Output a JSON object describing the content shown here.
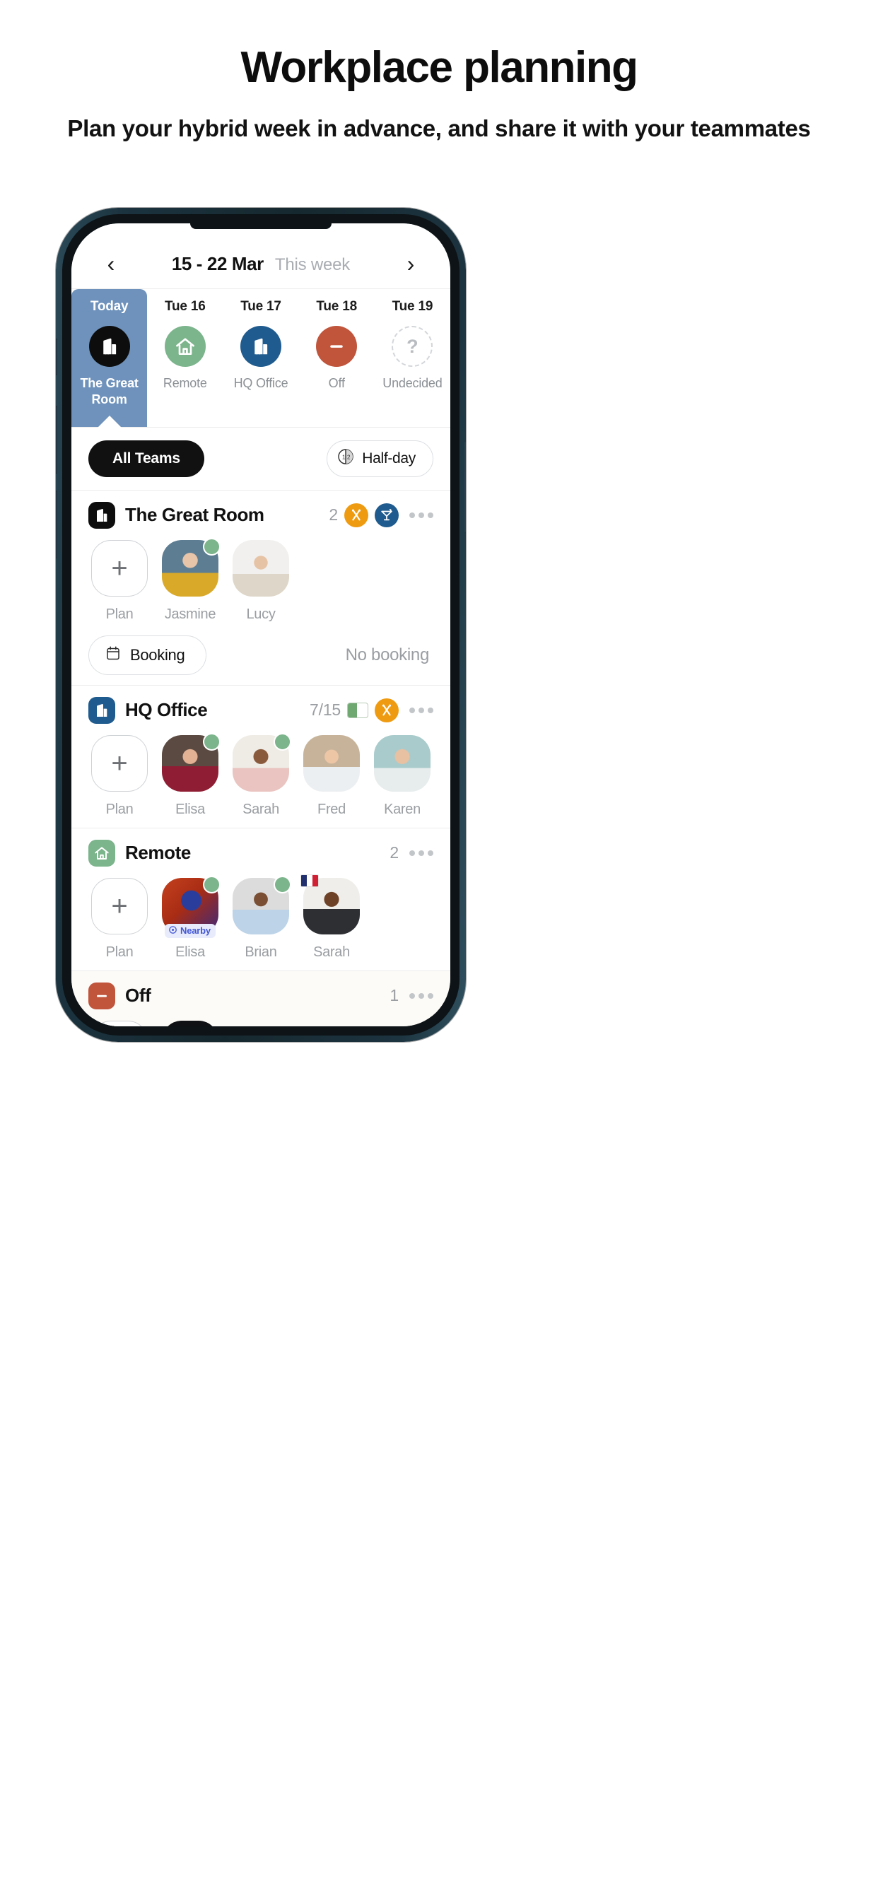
{
  "page": {
    "title": "Workplace planning",
    "subtitle": "Plan your hybrid week in advance, and share it with your teammates"
  },
  "app": {
    "nav": {
      "prev_icon": "chevron-left-icon",
      "next_icon": "chevron-right-icon",
      "date_range": "15 - 22 Mar",
      "week_label": "This week"
    },
    "days": [
      {
        "name": "Today",
        "label": "The Great Room",
        "icon": "office-building-icon",
        "icon_color": "#0d0d0d",
        "active": true
      },
      {
        "name": "Tue 16",
        "label": "Remote",
        "icon": "home-icon",
        "icon_color": "#7cb48c",
        "active": false
      },
      {
        "name": "Tue 17",
        "label": "HQ Office",
        "icon": "office-building-icon",
        "icon_color": "#1f5b8e",
        "active": false
      },
      {
        "name": "Tue 18",
        "label": "Off",
        "icon": "minus-circle-icon",
        "icon_color": "#c0553c",
        "active": false
      },
      {
        "name": "Tue 19",
        "label": "Undecided",
        "icon": "question-mark-icon",
        "icon_color": "#b9bdc1",
        "active": false
      }
    ],
    "filters": {
      "teams_label": "All Teams",
      "halfday_label": "Half-day",
      "halfday_icon": "half-day-icon"
    },
    "sections": [
      {
        "id": "the-great-room",
        "title": "The Great Room",
        "icon": "office-building-icon",
        "icon_bg": "#0d0d0d",
        "count": "2",
        "capacity": null,
        "badges": [
          {
            "name": "cutlery-icon",
            "color": "#ef9b12"
          },
          {
            "name": "cocktail-icon",
            "color": "#1f5b8e"
          }
        ],
        "menu_icon": "more-options-icon",
        "people": [
          {
            "name": "Plan",
            "type": "add",
            "icon": "plus-icon"
          },
          {
            "name": "Jasmine",
            "type": "avatar",
            "skin": "sk-jasmine",
            "status": true
          },
          {
            "name": "Lucy",
            "type": "avatar",
            "skin": "sk-lucy",
            "status": false
          }
        ],
        "booking": {
          "label": "Booking",
          "icon": "calendar-icon",
          "status": "No booking"
        }
      },
      {
        "id": "hq-office",
        "title": "HQ Office",
        "icon": "office-building-icon",
        "icon_bg": "#1f5b8e",
        "count": "7/15",
        "capacity": {
          "percent": 47,
          "fill_color": "#6fa870"
        },
        "badges": [
          {
            "name": "cutlery-icon",
            "color": "#ef9b12"
          }
        ],
        "menu_icon": "more-options-icon",
        "people": [
          {
            "name": "Plan",
            "type": "add",
            "icon": "plus-icon"
          },
          {
            "name": "Elisa",
            "type": "avatar",
            "skin": "sk-elisa",
            "status": true
          },
          {
            "name": "Sarah",
            "type": "avatar",
            "skin": "sk-sarah",
            "status": true
          },
          {
            "name": "Fred",
            "type": "avatar",
            "skin": "sk-fred",
            "status": false
          },
          {
            "name": "Karen",
            "type": "avatar",
            "skin": "sk-karen",
            "status": false
          }
        ],
        "booking": null
      },
      {
        "id": "remote",
        "title": "Remote",
        "icon": "home-icon",
        "icon_bg": "#7cb48c",
        "count": "2",
        "capacity": null,
        "badges": [],
        "menu_icon": "more-options-icon",
        "people": [
          {
            "name": "Plan",
            "type": "add",
            "icon": "plus-icon"
          },
          {
            "name": "Elisa",
            "type": "avatar",
            "skin": "sk-elisa2",
            "status": true,
            "tag": "Nearby",
            "tag_icon": "location-pin-icon"
          },
          {
            "name": "Brian",
            "type": "avatar",
            "skin": "sk-brian",
            "status": true
          },
          {
            "name": "Sarah",
            "type": "avatar",
            "skin": "sk-sarah2",
            "status": false,
            "flag": "france-flag"
          }
        ],
        "booking": null
      },
      {
        "id": "off",
        "title": "Off",
        "icon": "minus-circle-icon",
        "icon_bg": "#c0553c",
        "count": "1",
        "capacity": null,
        "badges": [],
        "menu_icon": "more-options-icon",
        "muted": true,
        "people": [
          {
            "name": "",
            "type": "add",
            "icon": "plus-icon"
          },
          {
            "name": "",
            "type": "avatar",
            "skin": "sk-george",
            "status": false
          }
        ],
        "booking": null
      }
    ]
  }
}
